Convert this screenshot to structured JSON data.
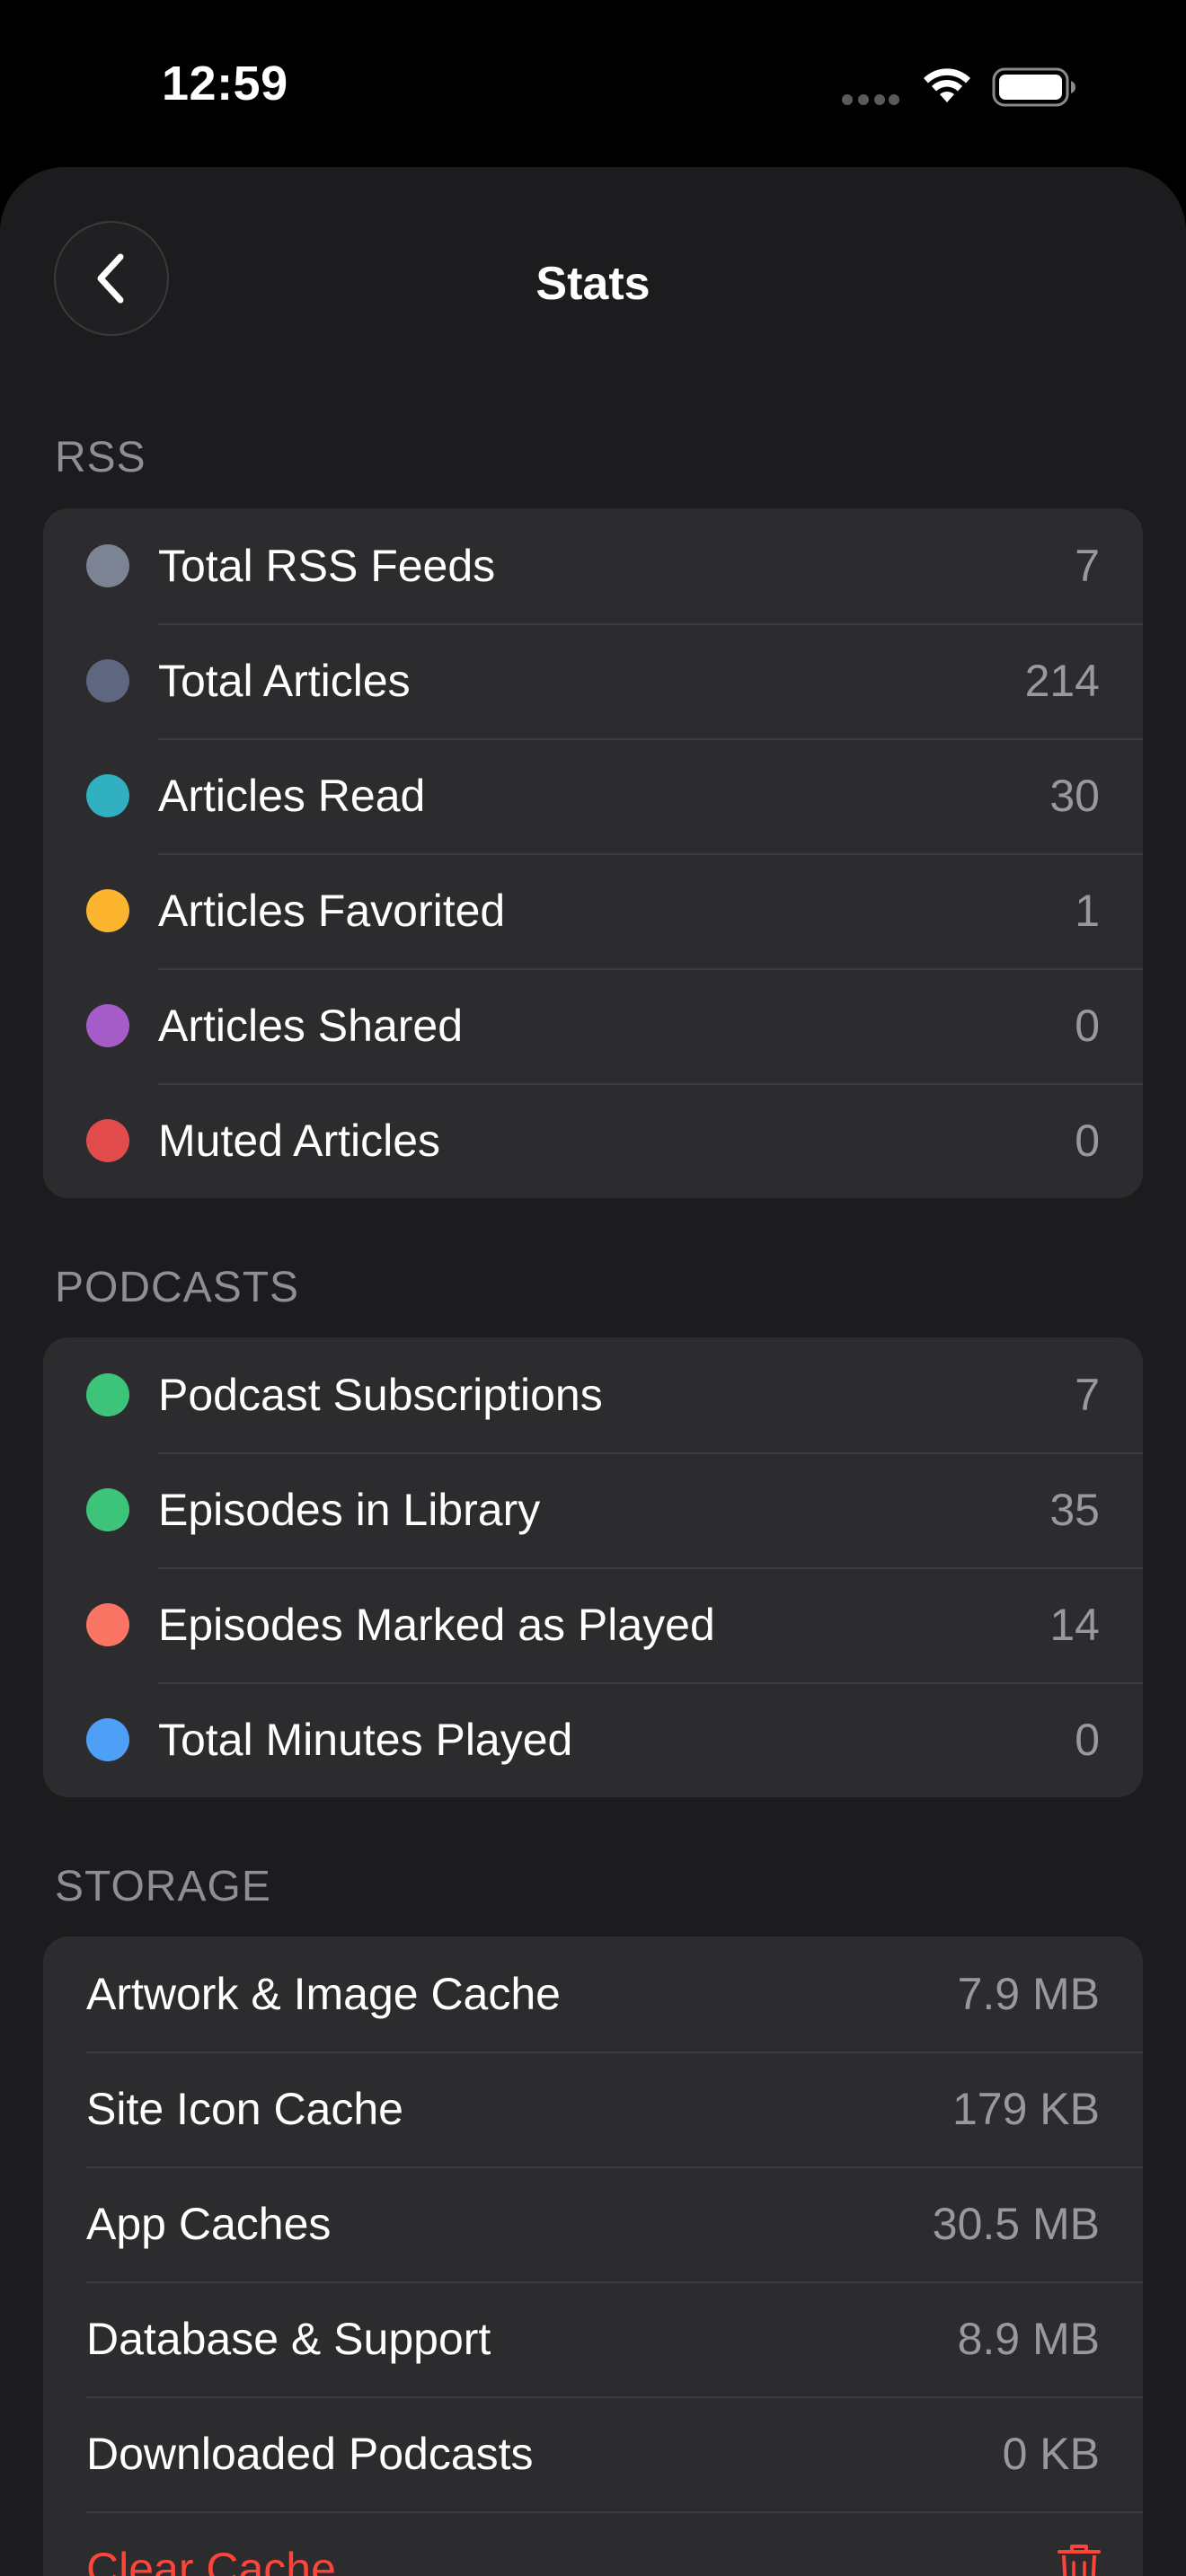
{
  "status_bar": {
    "time": "12:59"
  },
  "nav": {
    "title": "Stats",
    "back_icon": "chevron-left-icon"
  },
  "sections": {
    "rss": {
      "header": "RSS",
      "rows": [
        {
          "label": "Total RSS Feeds",
          "value": "7",
          "dot_color": "#7c8395"
        },
        {
          "label": "Total Articles",
          "value": "214",
          "dot_color": "#5f6780"
        },
        {
          "label": "Articles Read",
          "value": "30",
          "dot_color": "#30b0c0"
        },
        {
          "label": "Articles Favorited",
          "value": "1",
          "dot_color": "#fdb52f"
        },
        {
          "label": "Articles Shared",
          "value": "0",
          "dot_color": "#a55cc8"
        },
        {
          "label": "Muted Articles",
          "value": "0",
          "dot_color": "#e24b4b"
        }
      ]
    },
    "podcasts": {
      "header": "PODCASTS",
      "rows": [
        {
          "label": "Podcast Subscriptions",
          "value": "7",
          "dot_color": "#3ec47a"
        },
        {
          "label": "Episodes in Library",
          "value": "35",
          "dot_color": "#3ec47a"
        },
        {
          "label": "Episodes Marked as Played",
          "value": "14",
          "dot_color": "#fb7564"
        },
        {
          "label": "Total Minutes Played",
          "value": "0",
          "dot_color": "#4e9ff6"
        }
      ]
    },
    "storage": {
      "header": "STORAGE",
      "rows": [
        {
          "label": "Artwork & Image Cache",
          "value": "7.9 MB"
        },
        {
          "label": "Site Icon Cache",
          "value": "179 KB"
        },
        {
          "label": "App Caches",
          "value": "30.5 MB"
        },
        {
          "label": "Database & Support",
          "value": "8.9 MB"
        },
        {
          "label": "Downloaded Podcasts",
          "value": "0 KB"
        }
      ],
      "clear_cache": {
        "label": "Clear Cache",
        "icon": "trash-icon",
        "color": "#ff453a"
      }
    }
  }
}
